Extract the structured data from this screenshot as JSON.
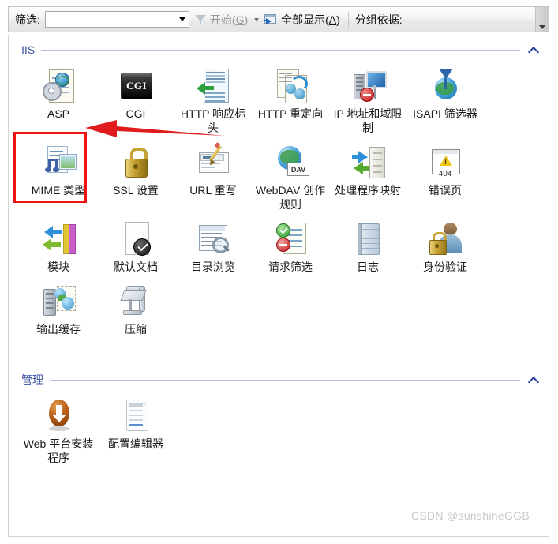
{
  "toolbar": {
    "filter_label": "筛选:",
    "filter_value": "",
    "filter_placeholder": "",
    "start_label_pre": "开始(",
    "start_label_key": "G",
    "start_label_post": ")",
    "show_all_pre": "全部显示(",
    "show_all_key": "A",
    "show_all_post": ")",
    "group_by_label": "分组依据:"
  },
  "groups": [
    {
      "title": "IIS",
      "items": [
        {
          "label": "ASP",
          "icon": "asp-icon"
        },
        {
          "label": "CGI",
          "icon": "cgi-icon"
        },
        {
          "label": "HTTP 响应标头",
          "icon": "http-response-headers-icon"
        },
        {
          "label": "HTTP 重定向",
          "icon": "http-redirect-icon"
        },
        {
          "label": "IP 地址和域限制",
          "icon": "ip-address-domain-restrictions-icon"
        },
        {
          "label": "ISAPI 筛选器",
          "icon": "isapi-filters-icon"
        },
        {
          "label": "MIME 类型",
          "icon": "mime-types-icon"
        },
        {
          "label": "SSL 设置",
          "icon": "ssl-settings-icon"
        },
        {
          "label": "URL 重写",
          "icon": "url-rewrite-icon"
        },
        {
          "label": "WebDAV 创作规则",
          "icon": "webdav-authoring-rules-icon"
        },
        {
          "label": "处理程序映射",
          "icon": "handler-mappings-icon"
        },
        {
          "label": "错误页",
          "icon": "error-pages-icon"
        },
        {
          "label": "模块",
          "icon": "modules-icon"
        },
        {
          "label": "默认文档",
          "icon": "default-document-icon"
        },
        {
          "label": "目录浏览",
          "icon": "directory-browsing-icon"
        },
        {
          "label": "请求筛选",
          "icon": "request-filtering-icon"
        },
        {
          "label": "日志",
          "icon": "logging-icon"
        },
        {
          "label": "身份验证",
          "icon": "authentication-icon"
        },
        {
          "label": "输出缓存",
          "icon": "output-caching-icon"
        },
        {
          "label": "压缩",
          "icon": "compression-icon"
        }
      ]
    },
    {
      "title": "管理",
      "items": [
        {
          "label": "Web 平台安装程序",
          "icon": "web-platform-installer-icon"
        },
        {
          "label": "配置编辑器",
          "icon": "configuration-editor-icon"
        }
      ]
    }
  ],
  "annotations": {
    "highlight_color": "#f01111",
    "arrow_color": "#e01b1b",
    "highlighted_item": "MIME 类型"
  },
  "watermark": "CSDN @sunshineGGB",
  "icons": {
    "webdav_tag": "DAV",
    "error_code": "404",
    "cgi_text": "CGI"
  }
}
